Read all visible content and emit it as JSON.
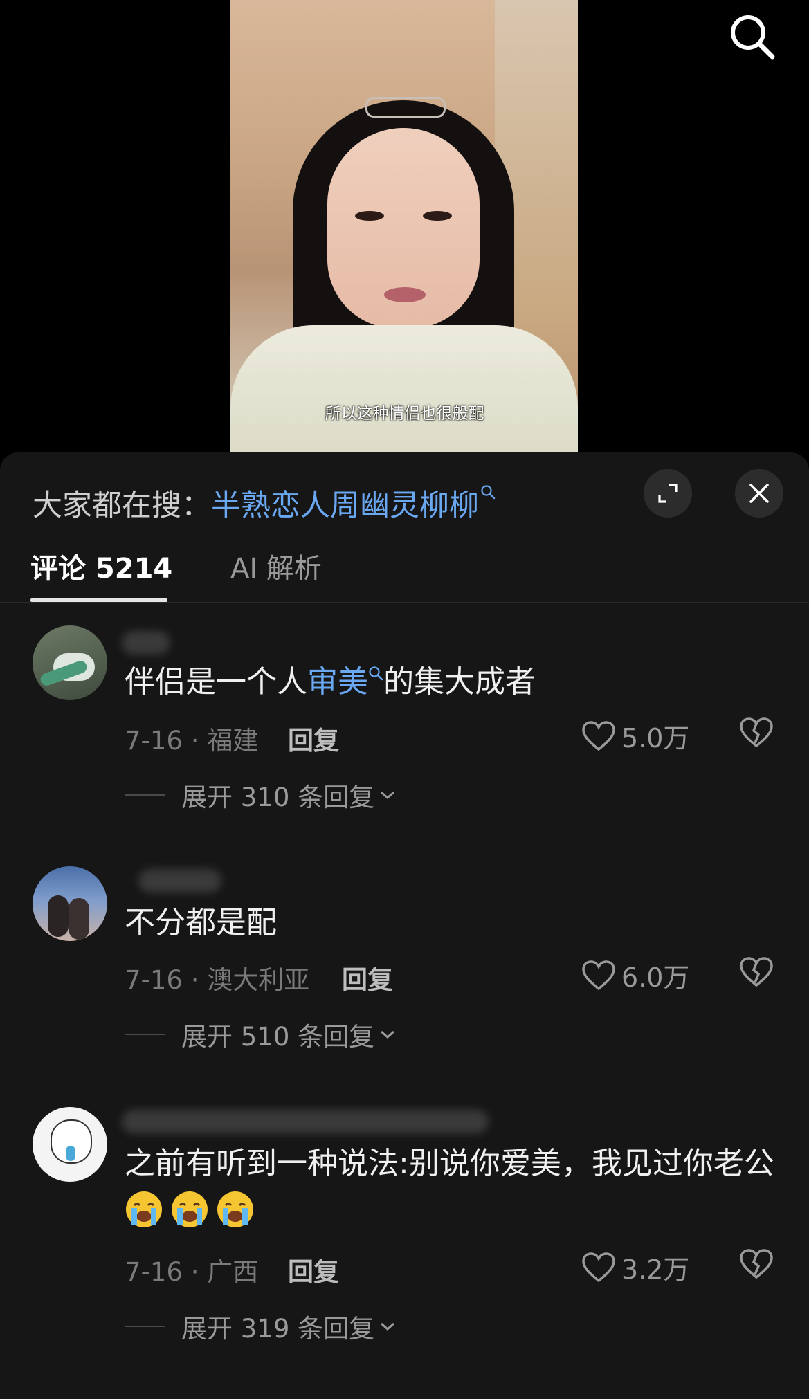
{
  "video": {
    "subtitle": "所以这种情侣也很般配"
  },
  "search_bar": {
    "prefix": "大家都在搜：",
    "keyword": "半熟恋人周幽灵柳柳"
  },
  "tabs": [
    {
      "label": "评论 5214",
      "active": true
    },
    {
      "label": "AI 解析",
      "active": false
    }
  ],
  "comments": [
    {
      "text_before": "伴侣是一个人",
      "keyword": "审美",
      "text_after": "的集大成者",
      "date_location": "7-16 · 福建",
      "reply_label": "回复",
      "likes": "5.0万",
      "expand_label": "展开 310 条回复"
    },
    {
      "text": "不分都是配",
      "date_location": "7-16 · 澳大利亚",
      "reply_label": "回复",
      "likes": "6.0万",
      "expand_label": "展开 510 条回复"
    },
    {
      "text": "之前有听到一种说法:别说你爱美，我见过你老公",
      "emoji_count": 3,
      "date_location": "7-16 · 广西",
      "reply_label": "回复",
      "likes": "3.2万",
      "expand_label": "展开 319 条回复"
    }
  ],
  "icons": {
    "search": "search-icon",
    "expand": "fullscreen-icon",
    "close": "close-icon",
    "like": "heart-outline-icon",
    "dislike": "broken-heart-icon",
    "chevron": "chevron-down-icon",
    "emoji": "crying-face-emoji"
  },
  "colors": {
    "keyword": "#6aa8f2",
    "sheet_bg": "#161616"
  }
}
